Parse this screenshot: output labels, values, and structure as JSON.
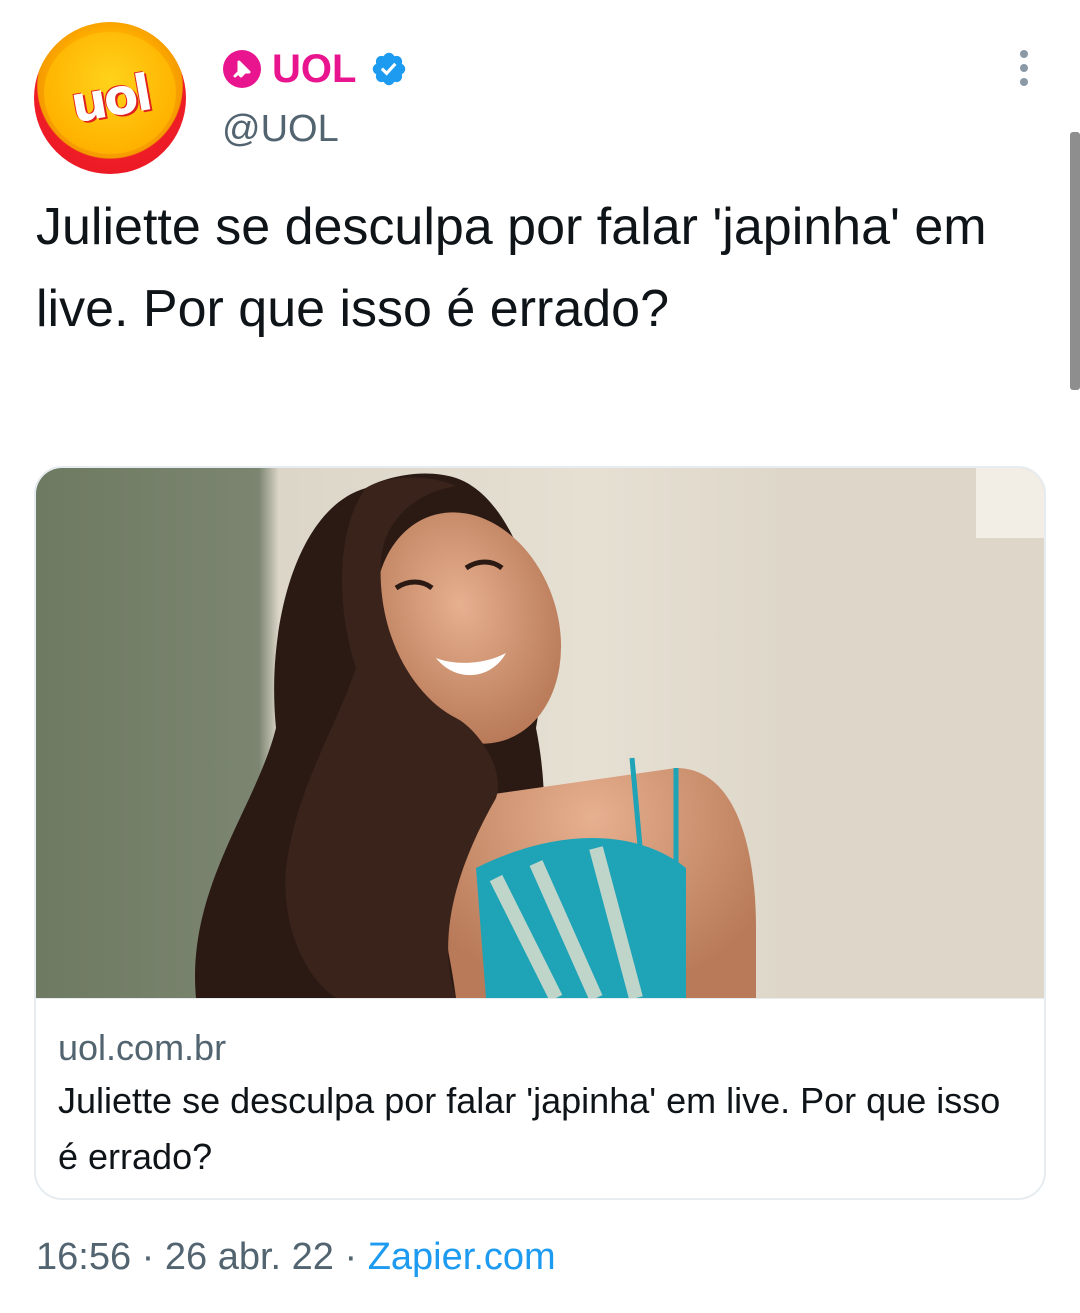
{
  "author": {
    "display_name": "UOL",
    "handle": "@UOL",
    "avatar_logo_text": "uol",
    "verified": true,
    "brand_color": "#e8158f",
    "verified_color": "#1d9bf0"
  },
  "tweet": {
    "text": "Juliette se desculpa por falar 'japinha' em live. Por que isso é errado?"
  },
  "card": {
    "image_icon": "article-photo",
    "domain": "uol.com.br",
    "title": "Juliette se desculpa por falar 'japinha' em live. Por que isso é errado?"
  },
  "meta": {
    "time": "16:56",
    "separator": "·",
    "date": "26 abr. 22",
    "source": "Zapier.com"
  },
  "icons": {
    "pin": "pin-badge-icon",
    "verified": "verified-badge-icon",
    "more": "more-vertical-icon"
  }
}
